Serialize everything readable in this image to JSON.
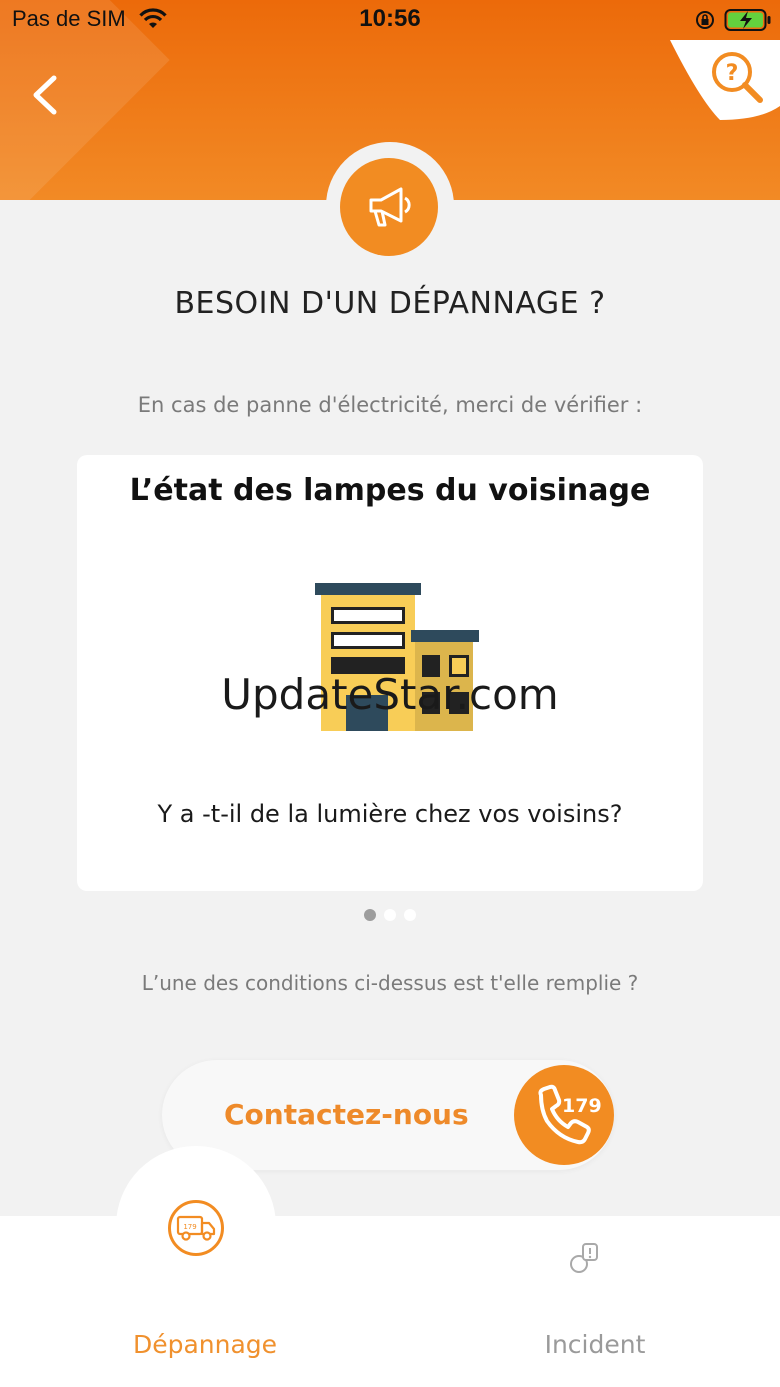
{
  "status_bar": {
    "carrier": "Pas de SIM",
    "time": "10:56"
  },
  "header": {
    "back_icon": "chevron-left-icon",
    "help_icon": "help-magnifier-icon",
    "banner_icon": "megaphone-icon"
  },
  "page": {
    "title": "BESOIN D'UN DÉPANNAGE ?",
    "intro": "En cas de panne d'électricité, merci de vérifier :",
    "conditions_question": "L’une des conditions ci-dessus est t'elle  remplie ?"
  },
  "carousel": {
    "card_title": "L’état des lampes du voisinage",
    "card_question": "Y a -t-il de la lumière chez vos voisins?",
    "watermark": "UpdateStar.com",
    "page_count": 3,
    "active_index": 0
  },
  "contact": {
    "label": "Contactez-nous",
    "phone_number": "179"
  },
  "tabbar": {
    "tabs": [
      {
        "label": "Dépannage",
        "active": true
      },
      {
        "label": "Incident",
        "active": false
      }
    ],
    "depannage_icon_number": "179"
  },
  "colors": {
    "accent": "#f28c22",
    "header_top": "#ec6a0a",
    "background": "#f2f2f2"
  }
}
